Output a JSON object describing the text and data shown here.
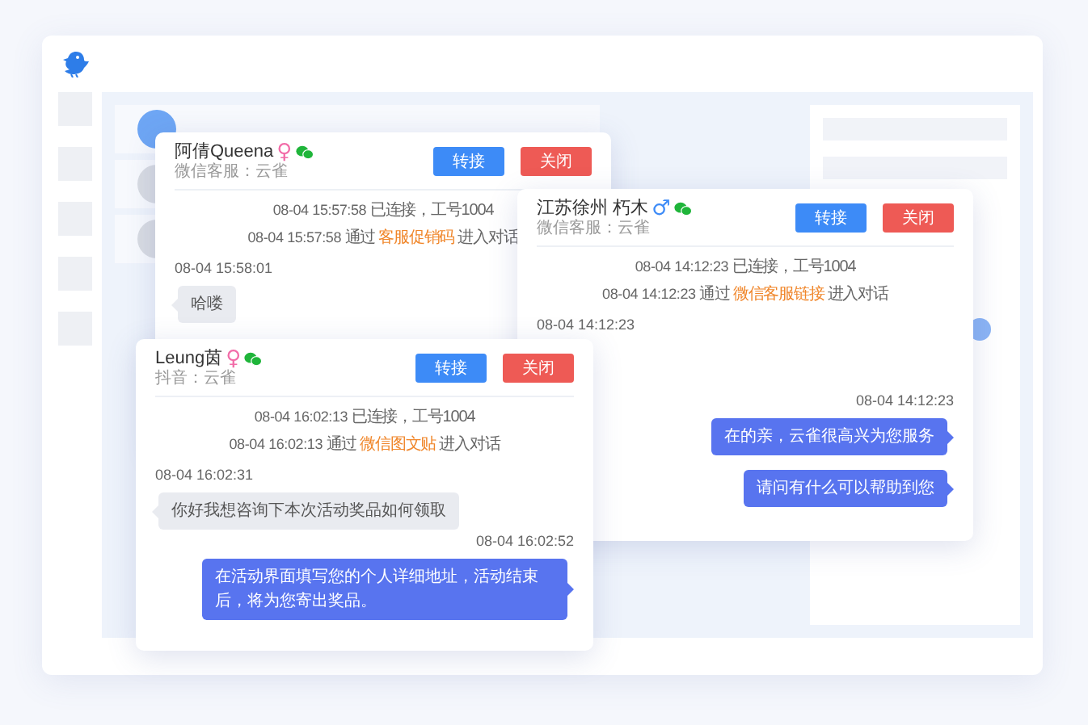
{
  "chats": [
    {
      "name": "阿倩Queena",
      "gender": {
        "symbol": "♀",
        "color": "#f26ca8"
      },
      "source": "微信客服：云雀",
      "transfer_button": "转接",
      "close_button": "关闭",
      "messages": [
        {
          "kind": "system",
          "time": "08-04 15:57:58",
          "text": "已连接，工号1004"
        },
        {
          "kind": "system",
          "time": "08-04 15:57:58",
          "text": "通过",
          "highlight": "客服促销码",
          "suffix": "进入对话"
        },
        {
          "kind": "received",
          "time": "08-04 15:58:01",
          "text": "哈喽"
        }
      ]
    },
    {
      "name": "江苏徐州 朽木",
      "gender": {
        "symbol": "♂",
        "color": "#3d8bf7"
      },
      "source": "微信客服：云雀",
      "transfer_button": "转接",
      "close_button": "关闭",
      "messages": [
        {
          "kind": "system",
          "time": "08-04 14:12:23",
          "text": "已连接，工号1004"
        },
        {
          "kind": "system",
          "time": "08-04 14:12:23",
          "text": "通过",
          "highlight": "微信客服链接",
          "suffix": "进入对话"
        },
        {
          "kind": "received",
          "time": "08-04 14:12:23"
        },
        {
          "kind": "sent",
          "time": "08-04 14:12:23",
          "text": "在的亲，云雀很高兴为您服务"
        },
        {
          "kind": "sent",
          "text": "请问有什么可以帮助到您"
        }
      ]
    },
    {
      "name": "Leung茵",
      "gender": {
        "symbol": "♀",
        "color": "#f26ca8"
      },
      "source": "抖音：云雀",
      "transfer_button": "转接",
      "close_button": "关闭",
      "messages": [
        {
          "kind": "system",
          "time": "08-04 16:02:13",
          "text": "已连接，工号1004"
        },
        {
          "kind": "system",
          "time": "08-04 16:02:13",
          "text": "通过",
          "highlight": "微信图文贴",
          "suffix": "进入对话"
        },
        {
          "kind": "received",
          "time": "08-04 16:02:31",
          "text": "你好我想咨询下本次活动奖品如何领取"
        },
        {
          "kind": "sent",
          "time": "08-04 16:02:52",
          "text": "在活动界面填写您的个人详细地址，活动结束后，将为您寄出奖品。"
        }
      ]
    }
  ]
}
